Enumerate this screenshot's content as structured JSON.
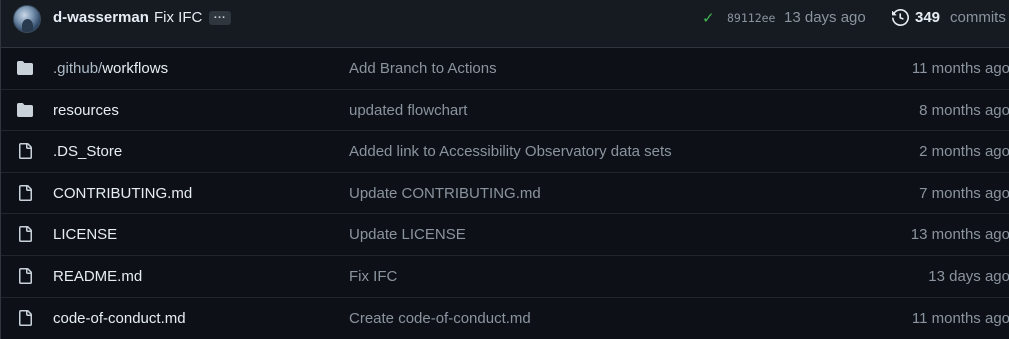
{
  "latest_commit": {
    "author": "d-wasserman",
    "message": "Fix IFC",
    "ellipsis": "...",
    "sha": "89112ee",
    "time": "13 days ago",
    "commit_count": "349",
    "commit_word": "commits"
  },
  "colors": {
    "background": "#0d1117",
    "header_bg": "#161b22",
    "success": "#3fb950",
    "muted_text": "#8b949e"
  },
  "files": [
    {
      "type": "folder",
      "icon": "folder-icon",
      "name_prefix": ".github/",
      "name": "workflows",
      "message": "Add Branch to Actions",
      "age": "11 months ago"
    },
    {
      "type": "folder",
      "icon": "folder-icon",
      "name_prefix": "",
      "name": "resources",
      "message": "updated flowchart",
      "age": "8 months ago"
    },
    {
      "type": "file",
      "icon": "file-icon",
      "name_prefix": "",
      "name": ".DS_Store",
      "message": "Added link to Accessibility Observatory data sets",
      "age": "2 months ago"
    },
    {
      "type": "file",
      "icon": "file-icon",
      "name_prefix": "",
      "name": "CONTRIBUTING.md",
      "message": "Update CONTRIBUTING.md",
      "age": "7 months ago"
    },
    {
      "type": "file",
      "icon": "file-icon",
      "name_prefix": "",
      "name": "LICENSE",
      "message": "Update LICENSE",
      "age": "13 months ago"
    },
    {
      "type": "file",
      "icon": "file-icon",
      "name_prefix": "",
      "name": "README.md",
      "message": "Fix IFC",
      "age": "13 days ago"
    },
    {
      "type": "file",
      "icon": "file-icon",
      "name_prefix": "",
      "name": "code-of-conduct.md",
      "message": "Create code-of-conduct.md",
      "age": "11 months ago"
    }
  ]
}
